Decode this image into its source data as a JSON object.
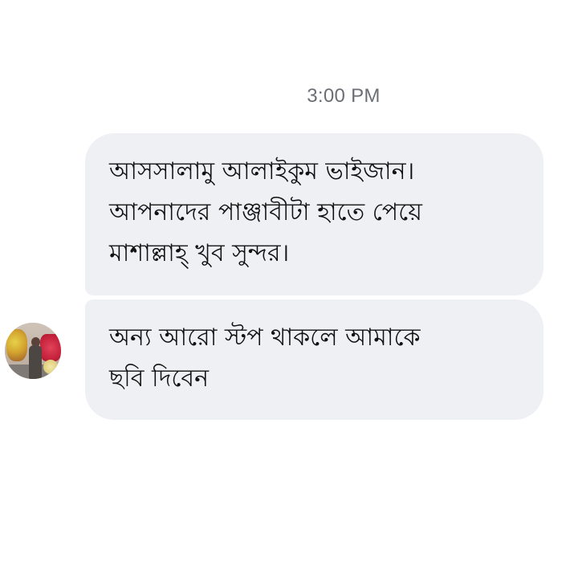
{
  "timestamp": "3:00 PM",
  "messages": [
    {
      "lines": [
        "আসসালামু আলাইকুম ভাইজান।",
        "আপনাদের পাঞ্জাবীটা হাতে পেয়ে",
        "মাশাল্লাহ্ খুব সুন্দর।"
      ]
    },
    {
      "lines": [
        "অন্য আরো স্টপ থাকলে আমাকে",
        "ছবি দিবেন"
      ]
    }
  ],
  "colors": {
    "bubble_background": "#eef0f3",
    "timestamp_text": "#6b6f75",
    "message_text": "#111111"
  },
  "avatar": {
    "icon": "contact-avatar-photo"
  }
}
